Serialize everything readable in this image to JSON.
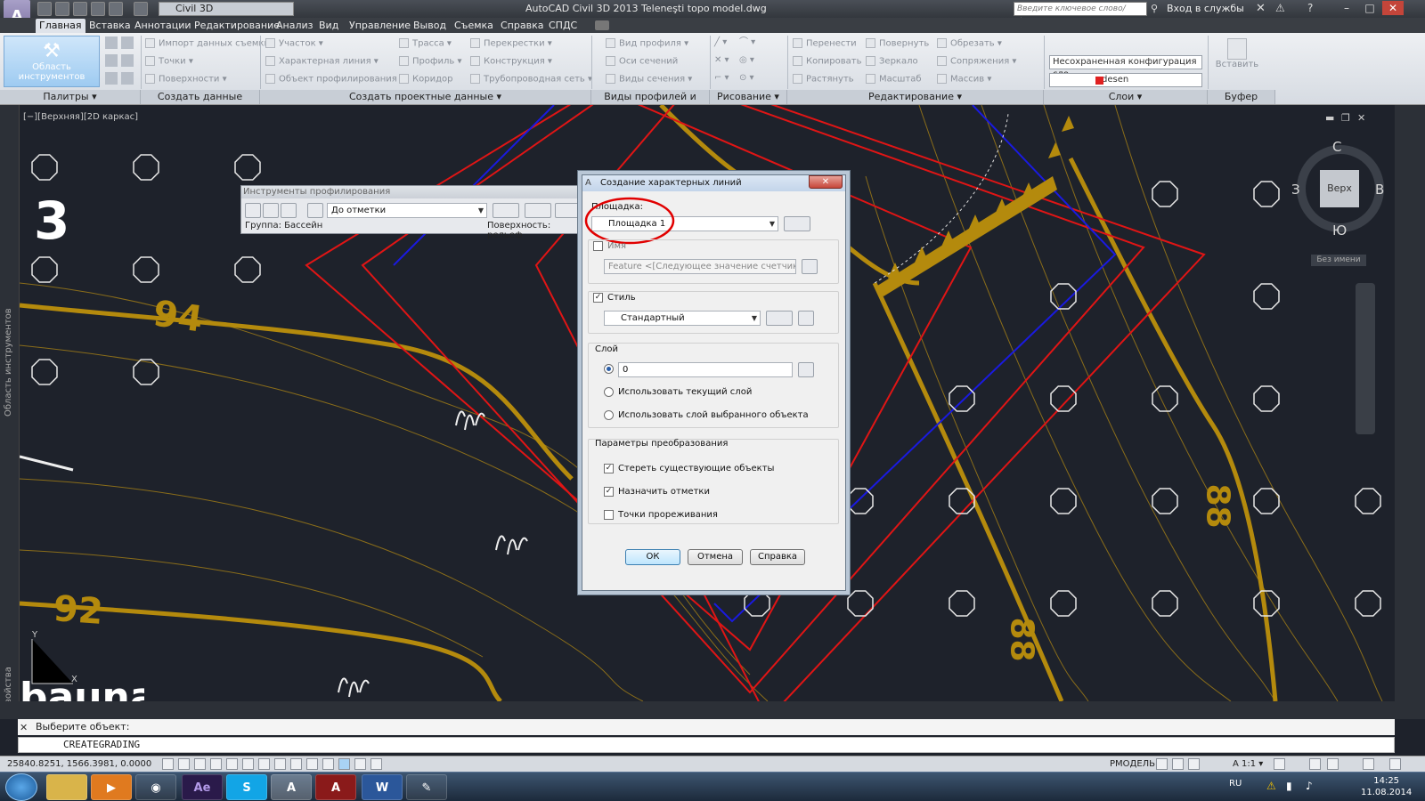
{
  "app": {
    "logo_letter": "A",
    "workspace": "Civil 3D",
    "window_title": "AutoCAD Civil 3D 2013   Teleneşti topo model.dwg",
    "search_placeholder": "Введите ключевое слово/фразу",
    "sign_in": "Вход в службы"
  },
  "tabs": [
    {
      "label": "Главная",
      "active": true
    },
    {
      "label": "Вставка"
    },
    {
      "label": "Аннотации"
    },
    {
      "label": "Редактирование"
    },
    {
      "label": "Анализ"
    },
    {
      "label": "Вид"
    },
    {
      "label": "Управление"
    },
    {
      "label": "Вывод"
    },
    {
      "label": "Съемка"
    },
    {
      "label": "Справка"
    },
    {
      "label": "СПДС"
    }
  ],
  "ribbon": {
    "tools_button": "Область инструментов",
    "survey": [
      "Импорт данных съемки",
      "Точки ▾",
      "Поверхности ▾"
    ],
    "design": [
      "Участок ▾",
      "Характерная линия ▾",
      "Объект профилирования ▾"
    ],
    "alignment": [
      "Трасса ▾",
      "Профиль ▾",
      "Коридор"
    ],
    "intersections": [
      "Перекрестки ▾",
      "Конструкция ▾",
      "Трубопроводная сеть ▾"
    ],
    "views": [
      "Вид профиля ▾",
      "Оси сечений",
      "Виды сечения ▾"
    ],
    "modify": [
      "Перенести",
      "Копировать",
      "Растянуть",
      "Повернуть",
      "Зеркало",
      "Масштаб",
      "Обрезать ▾",
      "Сопряжения ▾",
      "Массив ▾"
    ],
    "layer_config": "Несохраненная конфигурация сло",
    "layer_current": "desen",
    "paste": "Вставить",
    "panels": [
      "Палитры ▾",
      "Создать данные рельефа ▾",
      "Создать проектные данные ▾",
      "Виды профилей и сечений",
      "Рисование ▾",
      "Редактирование ▾",
      "Слои ▾",
      "Буфер обмена"
    ]
  },
  "canvas": {
    "view_label": "[−][Верхняя][2D каркас]",
    "viewcube_face": "Верх",
    "compass": {
      "n": "С",
      "s": "Ю",
      "w": "З",
      "e": "В"
    },
    "ucs_label": "Без имени",
    "contour_labels": [
      "94",
      "92",
      "88",
      "88"
    ],
    "big_label": "3",
    "bottom_text": "bauna",
    "annotation": "!!!"
  },
  "side": {
    "left_top": "Область инструментов",
    "left_bottom": "Свойства"
  },
  "palette": {
    "title": "Инструменты профилирования",
    "combo": "До отметки",
    "group": "Группа: Бассейн",
    "surface": "Поверхность: рельеф"
  },
  "dialog": {
    "title": "Создание характерных линий",
    "site_label": "Площадка:",
    "site_value": "Площадка 1",
    "name_label": "Имя",
    "name_value": "Feature <[Следующее значение счетчика(CP)]>",
    "style_label": "Стиль",
    "style_value": "Стандартный",
    "layer_label": "Слой",
    "layer_value": "0",
    "layer_opt_current": "Использовать текущий слой",
    "layer_opt_object": "Использовать слой выбранного объекта",
    "conversion_label": "Параметры преобразования",
    "opt_erase": "Стереть существующие объекты",
    "opt_elev": "Назначить отметки",
    "opt_weed": "Точки прореживания",
    "ok": "ОК",
    "cancel": "Отмена",
    "help": "Справка"
  },
  "command": {
    "prompt": "Выберите объект:",
    "input": "CREATEGRADING"
  },
  "status": {
    "coords": "25840.8251, 1566.3981, 0.0000",
    "model": "РМОДЕЛЬ",
    "scale": "1:1"
  },
  "taskbar": {
    "apps": [
      "explorer",
      "media",
      "chrome",
      "Ae",
      "S",
      "autocad",
      "autocad2",
      "W",
      "paint"
    ],
    "lang": "RU",
    "time": "14:25",
    "date": "11.08.2014"
  }
}
